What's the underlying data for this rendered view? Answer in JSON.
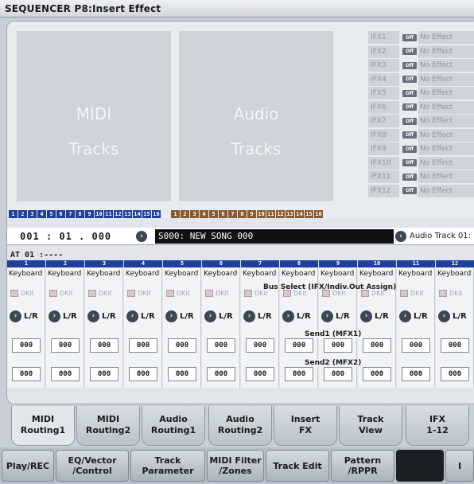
{
  "title": "SEQUENCER P8:Insert Effect",
  "tracks": {
    "midi_label_1": "MIDI",
    "midi_label_2": "Tracks",
    "audio_label_1": "Audio",
    "audio_label_2": "Tracks",
    "midi_numbers": [
      "1",
      "2",
      "3",
      "4",
      "5",
      "6",
      "7",
      "8",
      "9",
      "10",
      "11",
      "12",
      "13",
      "14",
      "15",
      "16"
    ],
    "audio_numbers": [
      "1",
      "2",
      "3",
      "4",
      "5",
      "6",
      "7",
      "8",
      "9",
      "10",
      "11",
      "12",
      "13",
      "14",
      "15",
      "16"
    ]
  },
  "ifx": [
    {
      "name": "IFX1",
      "state": "Off",
      "effect": "No Effect"
    },
    {
      "name": "IFX2",
      "state": "Off",
      "effect": "No Effect"
    },
    {
      "name": "IFX3",
      "state": "Off",
      "effect": "No Effect"
    },
    {
      "name": "IFX4",
      "state": "Off",
      "effect": "No Effect"
    },
    {
      "name": "IFX5",
      "state": "Off",
      "effect": "No Effect"
    },
    {
      "name": "IFX6",
      "state": "Off",
      "effect": "No Effect"
    },
    {
      "name": "IFX7",
      "state": "Off",
      "effect": "No Effect"
    },
    {
      "name": "IFX8",
      "state": "Off",
      "effect": "No Effect"
    },
    {
      "name": "IFX9",
      "state": "Off",
      "effect": "No Effect"
    },
    {
      "name": "IFX10",
      "state": "Off",
      "effect": "No Effect"
    },
    {
      "name": "IFX11",
      "state": "Off",
      "effect": "No Effect"
    },
    {
      "name": "IFX12",
      "state": "Off",
      "effect": "No Effect"
    }
  ],
  "location": {
    "position": "001 : 01 . 000",
    "song": "S000: NEW SONG 000",
    "audio_track": "Audio Track 01:"
  },
  "table": {
    "at_label": "AT 01 :----",
    "bus_select_label": "Bus Select (IFX/Indiv.Out Assign)",
    "send1_label": "Send1 (MFX1)",
    "send2_label": "Send2 (MFX2)",
    "columns": [
      {
        "num": "1",
        "bus": "Keyboard",
        "dkit": "DKit",
        "pan": "L/R",
        "send1": "000",
        "send2": "000"
      },
      {
        "num": "2",
        "bus": "Keyboard",
        "dkit": "DKit",
        "pan": "L/R",
        "send1": "000",
        "send2": "000"
      },
      {
        "num": "3",
        "bus": "Keyboard",
        "dkit": "DKit",
        "pan": "L/R",
        "send1": "000",
        "send2": "000"
      },
      {
        "num": "4",
        "bus": "Keyboard",
        "dkit": "DKit",
        "pan": "L/R",
        "send1": "000",
        "send2": "000"
      },
      {
        "num": "5",
        "bus": "Keyboard",
        "dkit": "DKit",
        "pan": "L/R",
        "send1": "000",
        "send2": "000"
      },
      {
        "num": "6",
        "bus": "Keyboard",
        "dkit": "DKit",
        "pan": "L/R",
        "send1": "000",
        "send2": "000"
      },
      {
        "num": "7",
        "bus": "Keyboard",
        "dkit": "DKit",
        "pan": "L/R",
        "send1": "000",
        "send2": "000"
      },
      {
        "num": "8",
        "bus": "Keyboard",
        "dkit": "DKit",
        "pan": "L/R",
        "send1": "000",
        "send2": "000"
      },
      {
        "num": "9",
        "bus": "Keyboard",
        "dkit": "DKit",
        "pan": "L/R",
        "send1": "000",
        "send2": "000"
      },
      {
        "num": "10",
        "bus": "Keyboard",
        "dkit": "DKit",
        "pan": "L/R",
        "send1": "000",
        "send2": "000"
      },
      {
        "num": "11",
        "bus": "Keyboard",
        "dkit": "DKit",
        "pan": "L/R",
        "send1": "000",
        "send2": "000"
      },
      {
        "num": "12",
        "bus": "Keyboard",
        "dkit": "DKit",
        "pan": "L/R",
        "send1": "000",
        "send2": "000"
      }
    ]
  },
  "tabs": [
    {
      "line1": "MIDI",
      "line2": "Routing1",
      "active": true
    },
    {
      "line1": "MIDI",
      "line2": "Routing2",
      "active": false
    },
    {
      "line1": "Audio",
      "line2": "Routing1",
      "active": false
    },
    {
      "line1": "Audio",
      "line2": "Routing2",
      "active": false
    },
    {
      "line1": "Insert",
      "line2": "FX",
      "active": false
    },
    {
      "line1": "Track",
      "line2": "View",
      "active": false
    },
    {
      "line1": "IFX",
      "line2": "1-12",
      "active": false
    }
  ],
  "bottom_nav": [
    {
      "line1": "Play/REC",
      "line2": ""
    },
    {
      "line1": "EQ/Vector",
      "line2": "/Control"
    },
    {
      "line1": "Track",
      "line2": "Parameter"
    },
    {
      "line1": "MIDI Filter",
      "line2": "/Zones"
    },
    {
      "line1": "Track Edit",
      "line2": ""
    },
    {
      "line1": "Pattern",
      "line2": "/RPPR"
    },
    {
      "line1": "",
      "line2": ""
    },
    {
      "line1": "I",
      "line2": ""
    }
  ]
}
